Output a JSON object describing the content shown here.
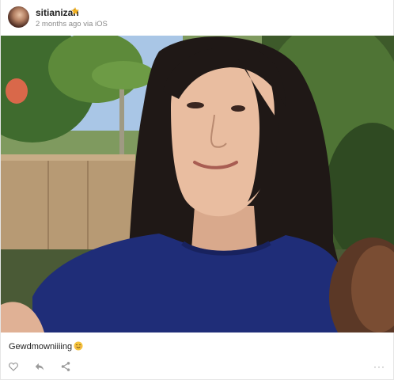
{
  "post": {
    "username": "sitianizah",
    "meta": "2 months ago via iOS",
    "caption": "Gewdmowniiiing",
    "more_label": "···"
  },
  "icons": {
    "verified": "star-icon",
    "caption_emoji": "smiling-emoji-icon",
    "like": "heart-icon",
    "reply": "reply-arrow-icon",
    "share": "share-icon",
    "more": "more-dots-icon"
  },
  "colors": {
    "star": "#f2b01e",
    "username": "#222222",
    "meta": "#8a8a8a",
    "action_icons": "#9a9a9a"
  }
}
